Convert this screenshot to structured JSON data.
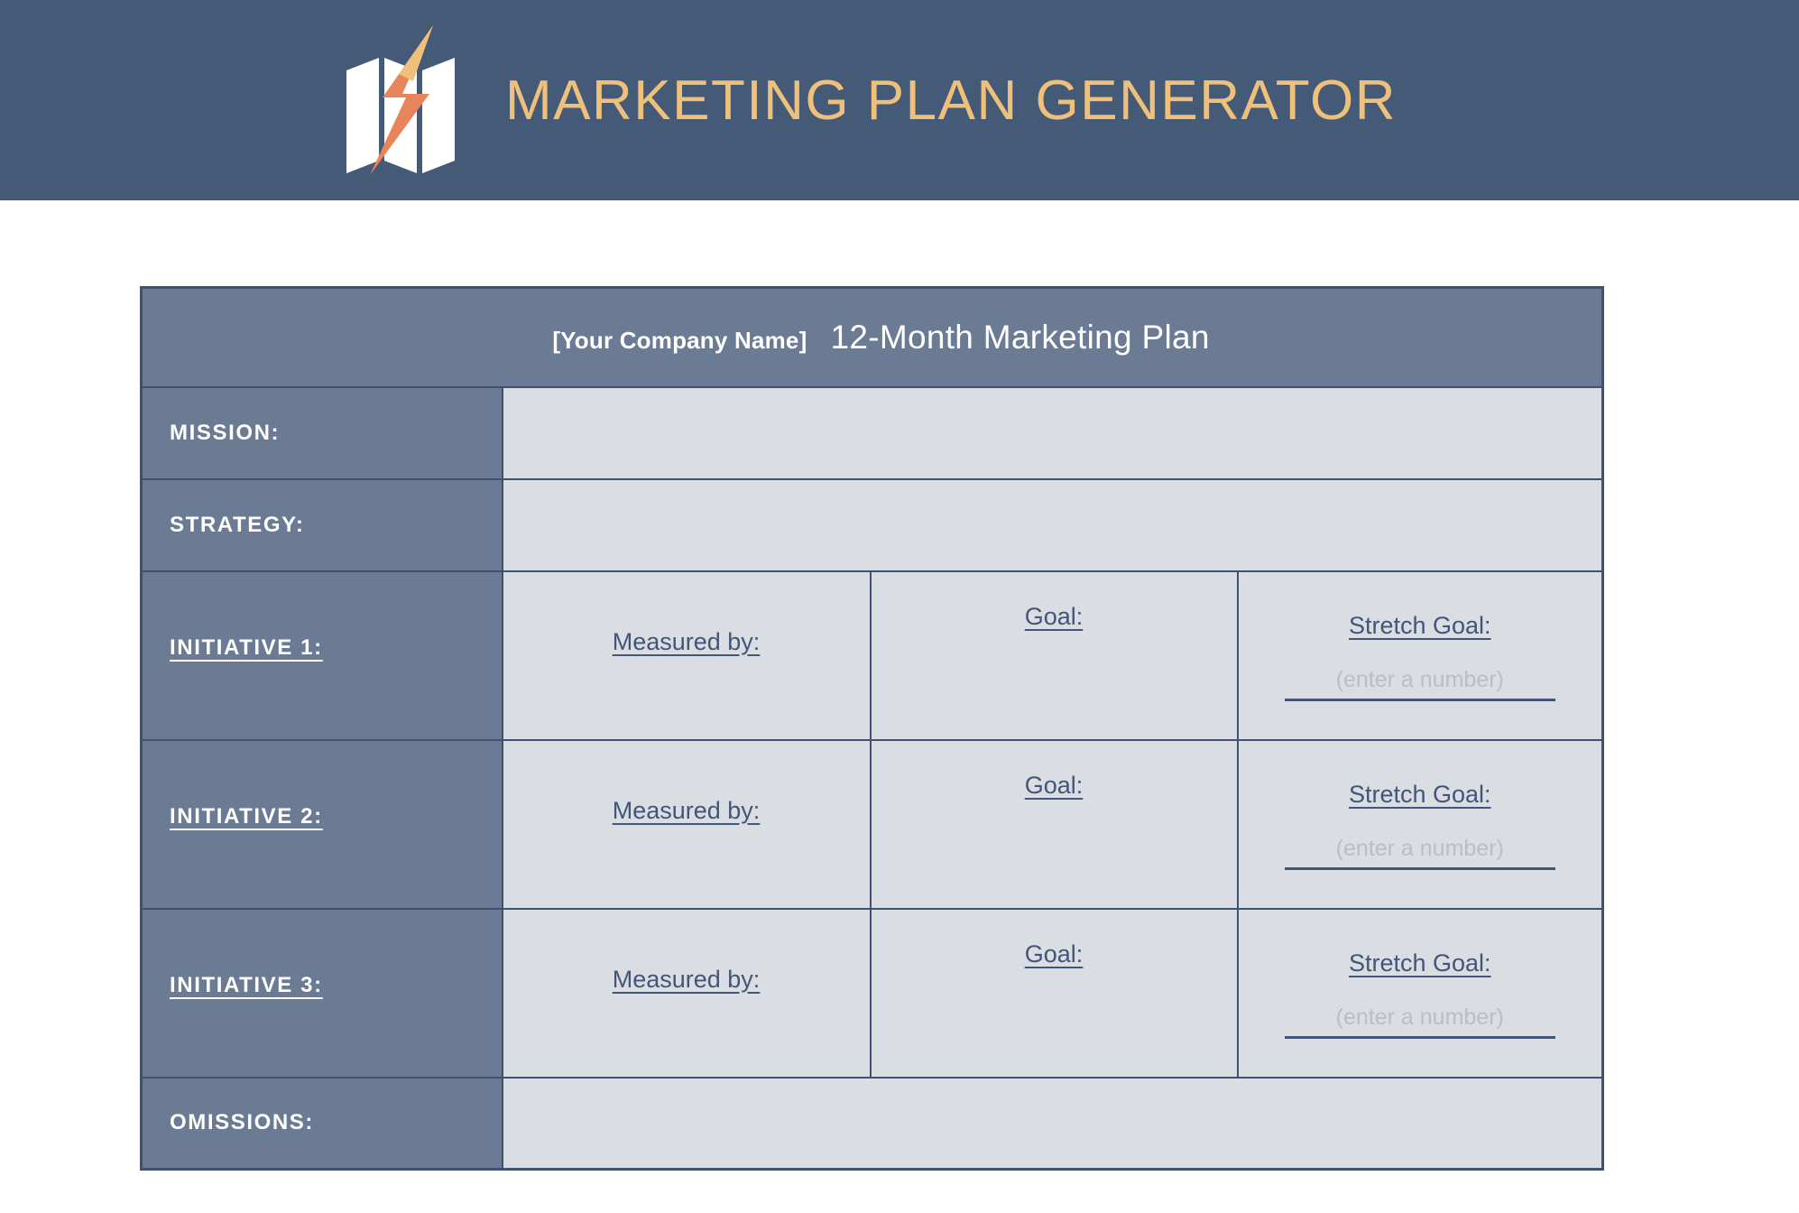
{
  "banner": {
    "title": "MARKETING PLAN GENERATOR",
    "logo_icon": "folded-map-lightning-bolt-logo",
    "background_color": "#455a76",
    "title_color": "#efc07a"
  },
  "table": {
    "header": {
      "company_placeholder": "[Your Company Name]",
      "plan_title": "12-Month Marketing Plan"
    },
    "colors": {
      "header_fill": "#6b7b93",
      "label_fill": "#6b7b93",
      "value_fill": "#dadde2",
      "border": "#3f5273",
      "link_text": "#44557a",
      "hint_text": "#b9bec7"
    },
    "rows": [
      {
        "label": "MISSION:",
        "underline": false,
        "value": ""
      },
      {
        "label": "STRATEGY:",
        "underline": false,
        "value": ""
      }
    ],
    "initiatives": [
      {
        "label": "INITIATIVE 1:",
        "underline": true,
        "measured_by": "Measured by:",
        "goal": "Goal:",
        "stretch_goal": "Stretch Goal:",
        "stretch_hint": "(enter a number)"
      },
      {
        "label": "INITIATIVE 2:",
        "underline": true,
        "measured_by": "Measured by:",
        "goal": "Goal:",
        "stretch_goal": "Stretch Goal:",
        "stretch_hint": "(enter a number)"
      },
      {
        "label": "INITIATIVE 3:",
        "underline": true,
        "measured_by": "Measured by:",
        "goal": "Goal:",
        "stretch_goal": "Stretch Goal:",
        "stretch_hint": "(enter a number)"
      }
    ],
    "omissions": {
      "label": "OMISSIONS:",
      "underline": false,
      "value": ""
    }
  }
}
